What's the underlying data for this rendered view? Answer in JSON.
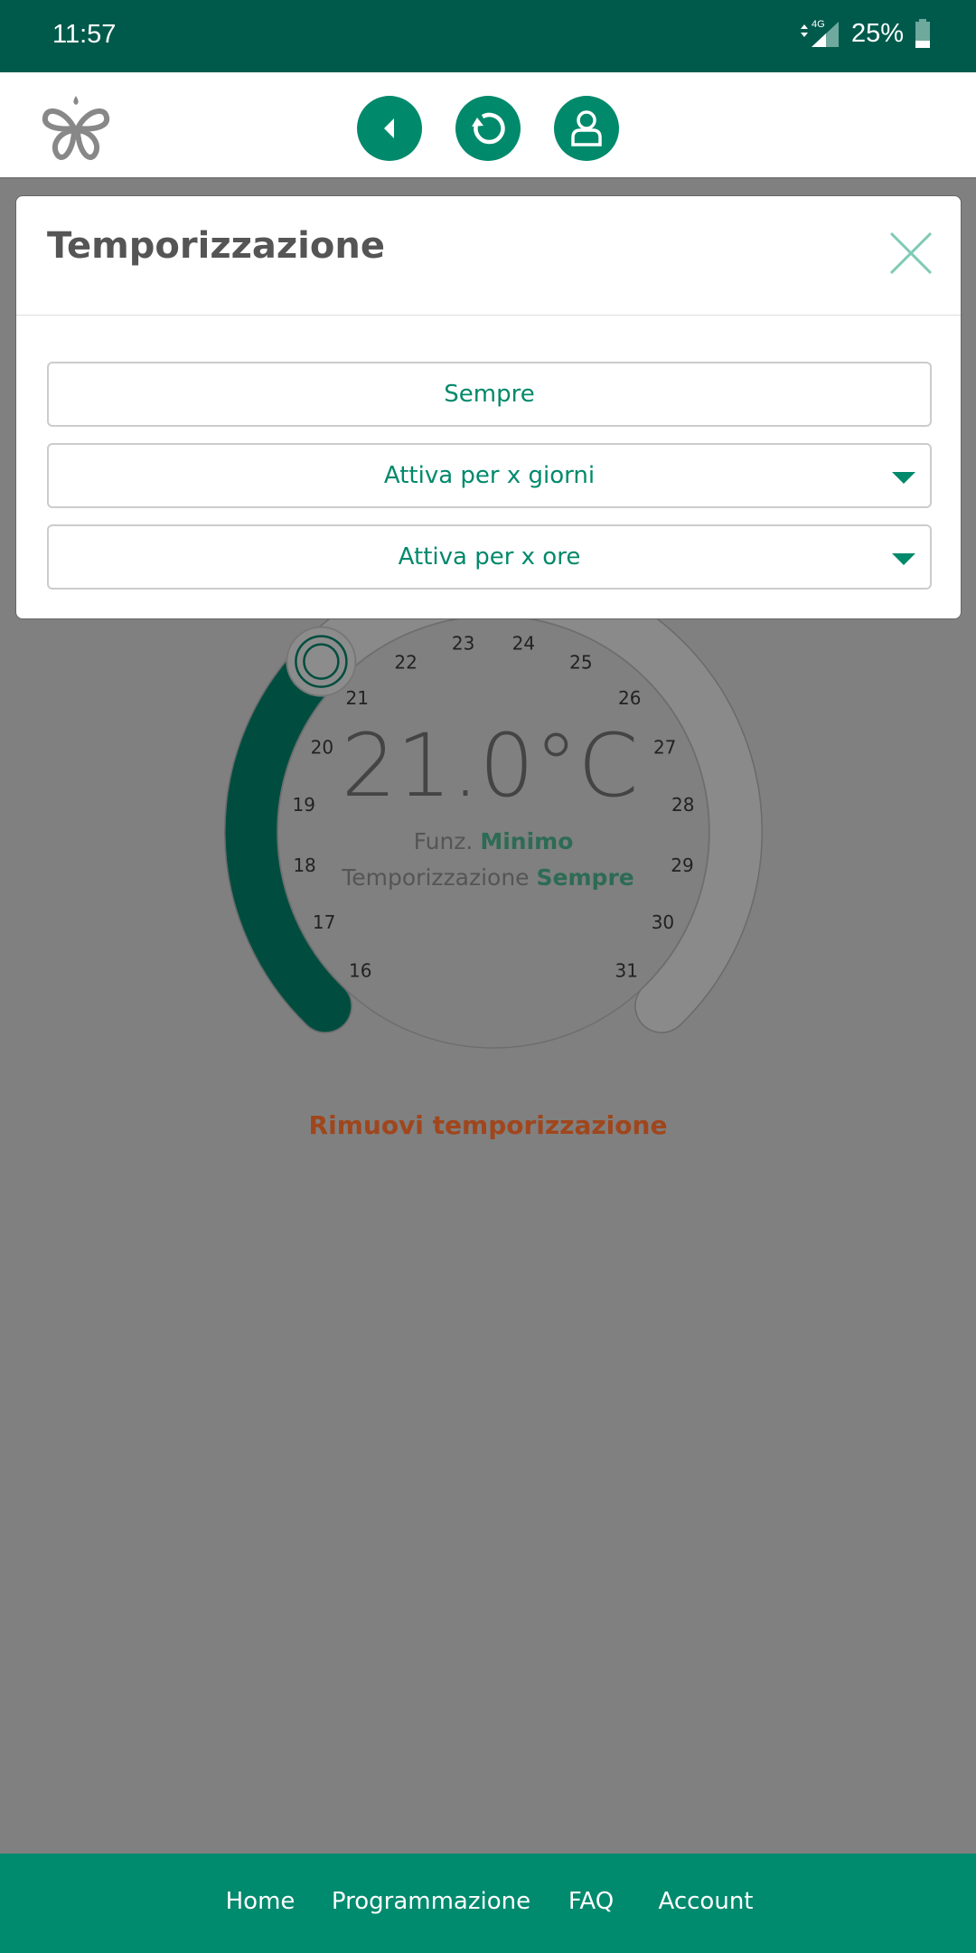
{
  "status_bar": {
    "time": "11:57",
    "network": "4G",
    "battery": "25%"
  },
  "header": {
    "logo": "butterfly-logo",
    "buttons": [
      {
        "name": "back",
        "icon": "back-triangle-icon"
      },
      {
        "name": "refresh",
        "icon": "refresh-icon"
      },
      {
        "name": "account",
        "icon": "user-icon"
      }
    ]
  },
  "modal": {
    "title": "Temporizzazione",
    "close_icon": "close-icon",
    "options": [
      {
        "label": "Sempre",
        "dropdown": false
      },
      {
        "label": "Attiva per x giorni",
        "dropdown": true
      },
      {
        "label": "Attiva per x ore",
        "dropdown": true
      }
    ]
  },
  "thermostat": {
    "temperature": "21.0°C",
    "value": 21,
    "min": 16,
    "max": 31,
    "scale_labels": [
      "16",
      "17",
      "18",
      "19",
      "20",
      "21",
      "22",
      "23",
      "24",
      "25",
      "26",
      "27",
      "28",
      "29",
      "30",
      "31"
    ],
    "mode_label": "Funz.",
    "mode_value": "Minimo",
    "timer_label": "Temporizzazione",
    "timer_value": "Sempre",
    "active_color": "#004d3f",
    "track_color": "#8a8a8a"
  },
  "remove_timer": "Rimuovi temporizzazione",
  "footer": {
    "items": [
      "Home",
      "Programmazione",
      "FAQ",
      "Account"
    ]
  },
  "colors": {
    "brand": "#00896b",
    "status_bar": "#005a4c",
    "remove": "#a0461c"
  }
}
